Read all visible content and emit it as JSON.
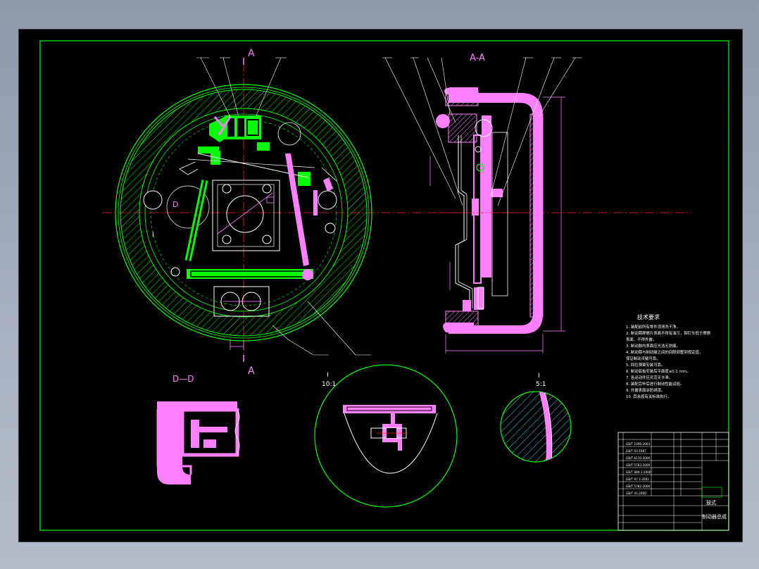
{
  "colors": {
    "background_frame": "#8e98a8",
    "sheet": "#000000",
    "border": "#00ff00",
    "part_green": "#00ff00",
    "part_magenta": "#ff80ff",
    "part_white": "#ffffff",
    "center_line": "#ff2020",
    "hatch_cyan": "#40e0e0"
  },
  "views": {
    "section_mark_top": "A",
    "section_mark_bottom": "A",
    "section_title_right": "A-A",
    "view_label_d": "D",
    "view_label_i": "I",
    "detail_dd_title": "D—D",
    "detail_i_title": "I",
    "detail_i_scale": "10:1",
    "detail_right_title": "I",
    "detail_right_scale": "5:1"
  },
  "notes": {
    "title": "技术要求",
    "lines": [
      "1. 装配前所有零件须清洗干净。",
      "2. 制动蹄摩擦片表面不得有油污，铆钉头低于摩擦",
      "   表面，不得外露。",
      "3. 制动鼓内表面应光洁无划痕。",
      "4. 制动蹄与制动鼓之间的间隙调整到规定值，",
      "   保证制动灵敏可靠。",
      "5. 回位弹簧安装可靠。",
      "6. 制动底板安装后平面度≤0.1 mm。",
      "7. 各运动件应灵活无卡滞。",
      "8. 装配完毕后进行制动性能试验。",
      "9. 外露表面涂防锈漆。",
      "10. 其余按有关标准执行。"
    ]
  },
  "title_block": {
    "product_line1": "鼓式",
    "product_line2": "制动器总成",
    "small_rows": [
      "GB/T 1096-2003",
      "GB/T 93-1987",
      "GB/T 6170-2000",
      "GB/T 5783-2000",
      "GB/T 889.1-2000",
      "GB/T 97.1-2002",
      "GB/T 5782-2000",
      "GB/T 41-2000"
    ]
  }
}
